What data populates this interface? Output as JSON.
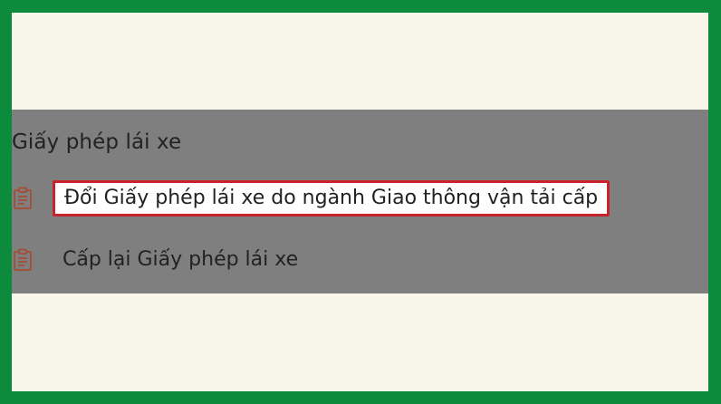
{
  "section": {
    "title": "Giấy phép lái xe"
  },
  "items": [
    {
      "label": "Đổi Giấy phép lái xe do ngành Giao thông vận tải cấp",
      "icon": "clipboard-document-icon",
      "highlighted": true
    },
    {
      "label": "Cấp lại Giấy phép lái xe",
      "icon": "clipboard-document-icon",
      "highlighted": false
    }
  ],
  "colors": {
    "frame_border": "#0b8b3b",
    "background": "#f8f6ea",
    "overlay": "#7f7f7f",
    "highlight_border": "#c8232c",
    "icon": "#a0523a"
  }
}
